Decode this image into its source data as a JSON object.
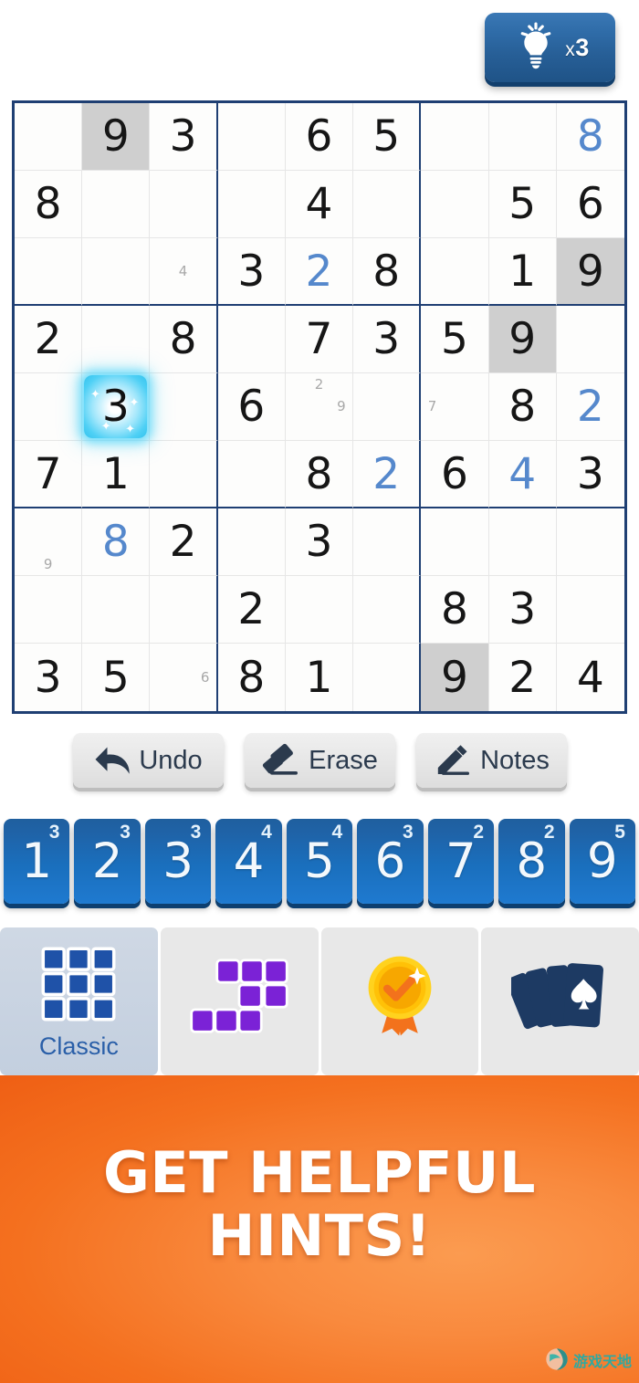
{
  "hint": {
    "icon": "lightbulb-icon",
    "multiplier_symbol": "x",
    "count": "3",
    "label": "x 3"
  },
  "board": {
    "selected_cell": {
      "row": 5,
      "col": 2,
      "value": "3"
    },
    "highlighted_value": "9",
    "rows": [
      [
        {
          "v": "",
          "t": "empty"
        },
        {
          "v": "9",
          "t": "given",
          "hl": true
        },
        {
          "v": "3",
          "t": "given"
        },
        {
          "v": "",
          "t": "empty"
        },
        {
          "v": "6",
          "t": "given"
        },
        {
          "v": "5",
          "t": "given"
        },
        {
          "v": "",
          "t": "empty"
        },
        {
          "v": "",
          "t": "empty"
        },
        {
          "v": "8",
          "t": "user"
        }
      ],
      [
        {
          "v": "8",
          "t": "given"
        },
        {
          "v": "",
          "t": "empty"
        },
        {
          "v": "",
          "t": "empty"
        },
        {
          "v": "",
          "t": "empty"
        },
        {
          "v": "4",
          "t": "given"
        },
        {
          "v": "",
          "t": "empty"
        },
        {
          "v": "",
          "t": "empty"
        },
        {
          "v": "5",
          "t": "given"
        },
        {
          "v": "6",
          "t": "given"
        }
      ],
      [
        {
          "v": "",
          "t": "empty"
        },
        {
          "v": "",
          "t": "empty"
        },
        {
          "v": "",
          "t": "notes",
          "notes": [
            "",
            "",
            "",
            "",
            "4",
            "",
            "",
            "",
            ""
          ]
        },
        {
          "v": "3",
          "t": "given"
        },
        {
          "v": "2",
          "t": "user"
        },
        {
          "v": "8",
          "t": "given"
        },
        {
          "v": "",
          "t": "empty"
        },
        {
          "v": "1",
          "t": "given"
        },
        {
          "v": "9",
          "t": "given",
          "hl": true
        }
      ],
      [
        {
          "v": "2",
          "t": "given"
        },
        {
          "v": "",
          "t": "empty"
        },
        {
          "v": "8",
          "t": "given"
        },
        {
          "v": "",
          "t": "empty"
        },
        {
          "v": "7",
          "t": "given"
        },
        {
          "v": "3",
          "t": "given"
        },
        {
          "v": "5",
          "t": "given"
        },
        {
          "v": "9",
          "t": "given",
          "hl": true
        },
        {
          "v": "",
          "t": "empty"
        }
      ],
      [
        {
          "v": "",
          "t": "empty"
        },
        {
          "v": "3",
          "t": "selected"
        },
        {
          "v": "",
          "t": "empty"
        },
        {
          "v": "6",
          "t": "given"
        },
        {
          "v": "",
          "t": "notes",
          "notes": [
            "",
            "2",
            "",
            "",
            "",
            "9",
            "",
            "",
            ""
          ]
        },
        {
          "v": "",
          "t": "empty"
        },
        {
          "v": "",
          "t": "notes",
          "notes": [
            "",
            "",
            "",
            "7",
            "",
            "",
            "",
            "",
            ""
          ]
        },
        {
          "v": "8",
          "t": "given"
        },
        {
          "v": "2",
          "t": "user"
        }
      ],
      [
        {
          "v": "7",
          "t": "given"
        },
        {
          "v": "1",
          "t": "given"
        },
        {
          "v": "",
          "t": "empty"
        },
        {
          "v": "",
          "t": "empty"
        },
        {
          "v": "8",
          "t": "given"
        },
        {
          "v": "2",
          "t": "user"
        },
        {
          "v": "6",
          "t": "given"
        },
        {
          "v": "4",
          "t": "user"
        },
        {
          "v": "3",
          "t": "given"
        }
      ],
      [
        {
          "v": "",
          "t": "notes",
          "notes": [
            "",
            "",
            "",
            "",
            "",
            "",
            "",
            "9",
            ""
          ]
        },
        {
          "v": "8",
          "t": "user"
        },
        {
          "v": "2",
          "t": "given"
        },
        {
          "v": "",
          "t": "empty"
        },
        {
          "v": "3",
          "t": "given"
        },
        {
          "v": "",
          "t": "empty"
        },
        {
          "v": "",
          "t": "empty"
        },
        {
          "v": "",
          "t": "empty"
        },
        {
          "v": "",
          "t": "empty"
        }
      ],
      [
        {
          "v": "",
          "t": "empty"
        },
        {
          "v": "",
          "t": "empty"
        },
        {
          "v": "",
          "t": "empty"
        },
        {
          "v": "2",
          "t": "given"
        },
        {
          "v": "",
          "t": "empty"
        },
        {
          "v": "",
          "t": "empty"
        },
        {
          "v": "8",
          "t": "given"
        },
        {
          "v": "3",
          "t": "given"
        },
        {
          "v": "",
          "t": "empty"
        }
      ],
      [
        {
          "v": "3",
          "t": "given"
        },
        {
          "v": "5",
          "t": "given"
        },
        {
          "v": "",
          "t": "notes",
          "notes": [
            "",
            "",
            "",
            "",
            "",
            "6",
            "",
            "",
            ""
          ]
        },
        {
          "v": "8",
          "t": "given"
        },
        {
          "v": "1",
          "t": "given"
        },
        {
          "v": "",
          "t": "empty"
        },
        {
          "v": "9",
          "t": "given",
          "hl": true
        },
        {
          "v": "2",
          "t": "given"
        },
        {
          "v": "4",
          "t": "given"
        }
      ]
    ]
  },
  "actions": [
    {
      "label": "Undo",
      "icon": "undo-arrow-icon"
    },
    {
      "label": "Erase",
      "icon": "eraser-icon"
    },
    {
      "label": "Notes",
      "icon": "pencil-icon"
    }
  ],
  "numpad": [
    {
      "digit": "1",
      "remaining": "3"
    },
    {
      "digit": "2",
      "remaining": "3"
    },
    {
      "digit": "3",
      "remaining": "3"
    },
    {
      "digit": "4",
      "remaining": "4"
    },
    {
      "digit": "5",
      "remaining": "4"
    },
    {
      "digit": "6",
      "remaining": "3"
    },
    {
      "digit": "7",
      "remaining": "2"
    },
    {
      "digit": "8",
      "remaining": "2"
    },
    {
      "digit": "9",
      "remaining": "5"
    }
  ],
  "tabs": [
    {
      "label": "Classic",
      "icon": "sudoku-grid-icon",
      "active": true
    },
    {
      "label": "",
      "icon": "block-puzzle-icon",
      "active": false
    },
    {
      "label": "",
      "icon": "award-badge-icon",
      "active": false
    },
    {
      "label": "",
      "icon": "playing-cards-icon",
      "active": false
    }
  ],
  "banner": {
    "line1": "GET HELPFUL",
    "line2": "HINTS!"
  },
  "watermark": {
    "text": "游戏天地"
  },
  "colors": {
    "grid_border": "#1f3f73",
    "user_digit": "#5588cc",
    "highlight_cell": "#cfcfcf",
    "selected_glow": "#4fd0f5",
    "numpad_blue": "#1a6fbd",
    "banner_orange": "#f4701f",
    "tab_active": "#c3cfdf",
    "classic_label": "#2a5fa8"
  }
}
